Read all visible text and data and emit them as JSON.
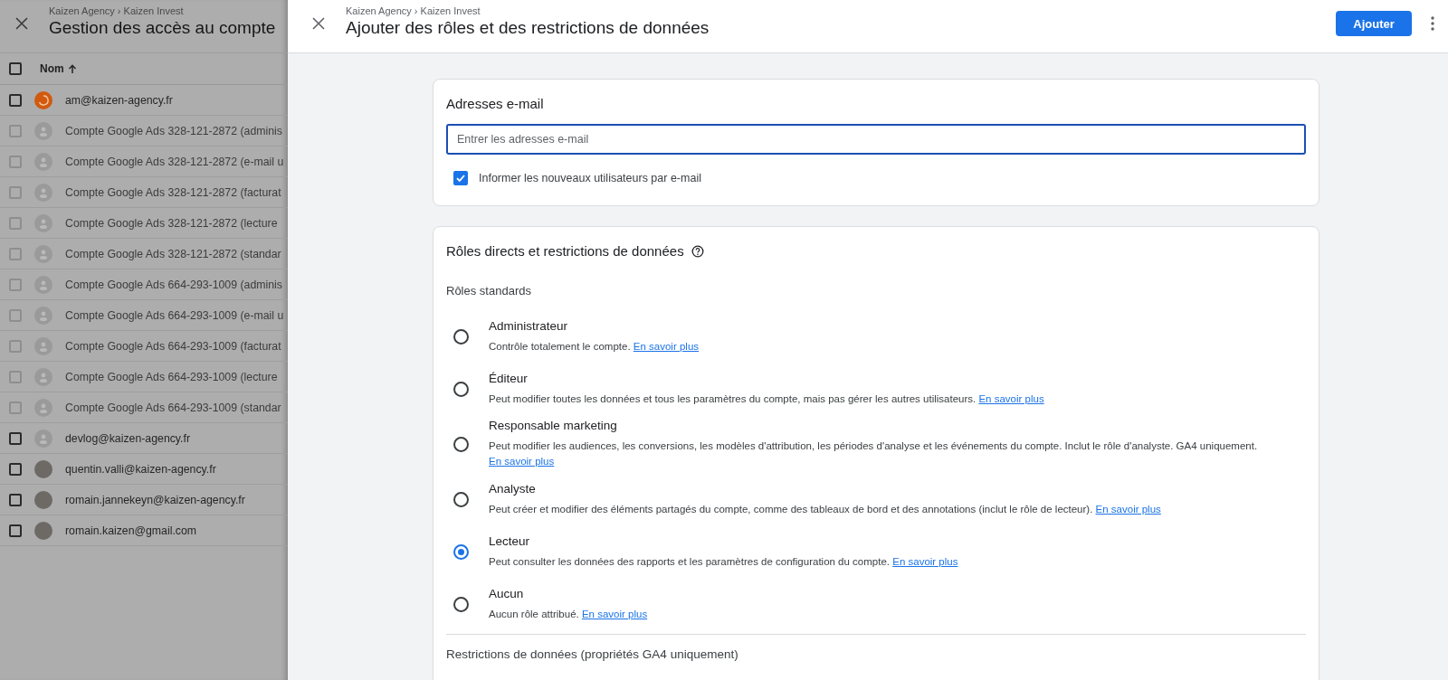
{
  "background_page": {
    "breadcrumb": "Kaizen Agency › Kaizen Invest",
    "title": "Gestion des accès au compte",
    "column": {
      "label": "Nom",
      "checked": false
    },
    "rows": [
      {
        "name": "am@kaizen-agency.fr",
        "kind": "logo",
        "checked": false,
        "disabled": false
      },
      {
        "name": "Compte Google Ads 328-121-2872 (adminis",
        "kind": "generic",
        "checked": false,
        "disabled": true
      },
      {
        "name": "Compte Google Ads 328-121-2872 (e-mail u",
        "kind": "generic",
        "checked": false,
        "disabled": true
      },
      {
        "name": "Compte Google Ads 328-121-2872 (facturat",
        "kind": "generic",
        "checked": false,
        "disabled": true
      },
      {
        "name": "Compte Google Ads 328-121-2872 (lecture",
        "kind": "generic",
        "checked": false,
        "disabled": true
      },
      {
        "name": "Compte Google Ads 328-121-2872 (standar",
        "kind": "generic",
        "checked": false,
        "disabled": true
      },
      {
        "name": "Compte Google Ads 664-293-1009 (adminis",
        "kind": "generic",
        "checked": false,
        "disabled": true
      },
      {
        "name": "Compte Google Ads 664-293-1009 (e-mail u",
        "kind": "generic",
        "checked": false,
        "disabled": true
      },
      {
        "name": "Compte Google Ads 664-293-1009 (facturat",
        "kind": "generic",
        "checked": false,
        "disabled": true
      },
      {
        "name": "Compte Google Ads 664-293-1009 (lecture",
        "kind": "generic",
        "checked": false,
        "disabled": true
      },
      {
        "name": "Compte Google Ads 664-293-1009 (standar",
        "kind": "generic",
        "checked": false,
        "disabled": true
      },
      {
        "name": "devlog@kaizen-agency.fr",
        "kind": "generic",
        "checked": false,
        "disabled": false
      },
      {
        "name": "quentin.valli@kaizen-agency.fr",
        "kind": "photo",
        "checked": false,
        "disabled": false
      },
      {
        "name": "romain.jannekeyn@kaizen-agency.fr",
        "kind": "photo",
        "checked": false,
        "disabled": false
      },
      {
        "name": "romain.kaizen@gmail.com",
        "kind": "photo",
        "checked": false,
        "disabled": false
      }
    ]
  },
  "panel": {
    "breadcrumb": "Kaizen Agency › Kaizen Invest",
    "title": "Ajouter des rôles et des restrictions de données",
    "add_button": "Ajouter"
  },
  "email_card": {
    "title": "Adresses e-mail",
    "field": {
      "placeholder": "Entrer les adresses e-mail"
    },
    "notify": {
      "label": "Informer les nouveaux utilisateurs par e-mail",
      "checked": true
    }
  },
  "roles_card": {
    "title": "Rôles directs et restrictions de données",
    "section": "Rôles standards",
    "roles": [
      {
        "name": "Administrateur",
        "description": "Contrôle totalement le compte.",
        "link": "En savoir plus",
        "selected": false
      },
      {
        "name": "Éditeur",
        "description": "Peut modifier toutes les données et tous les paramètres du compte, mais pas gérer les autres utilisateurs.",
        "link": "En savoir plus",
        "selected": false
      },
      {
        "name": "Responsable marketing",
        "description": "Peut modifier les audiences, les conversions, les modèles d'attribution, les périodes d'analyse et les événements du compte. Inclut le rôle d'analyste. GA4 uniquement.",
        "link": "En savoir plus",
        "selected": false
      },
      {
        "name": "Analyste",
        "description": "Peut créer et modifier des éléments partagés du compte, comme des tableaux de bord et des annotations (inclut le rôle de lecteur).",
        "link": "En savoir plus",
        "selected": false
      },
      {
        "name": "Lecteur",
        "description": "Peut consulter les données des rapports et les paramètres de configuration du compte.",
        "link": "En savoir plus",
        "selected": true
      },
      {
        "name": "Aucun",
        "description": "Aucun rôle attribué.",
        "link": "En savoir plus",
        "selected": false
      }
    ],
    "restrictions_title": "Restrictions de données (propriétés GA4 uniquement)"
  }
}
